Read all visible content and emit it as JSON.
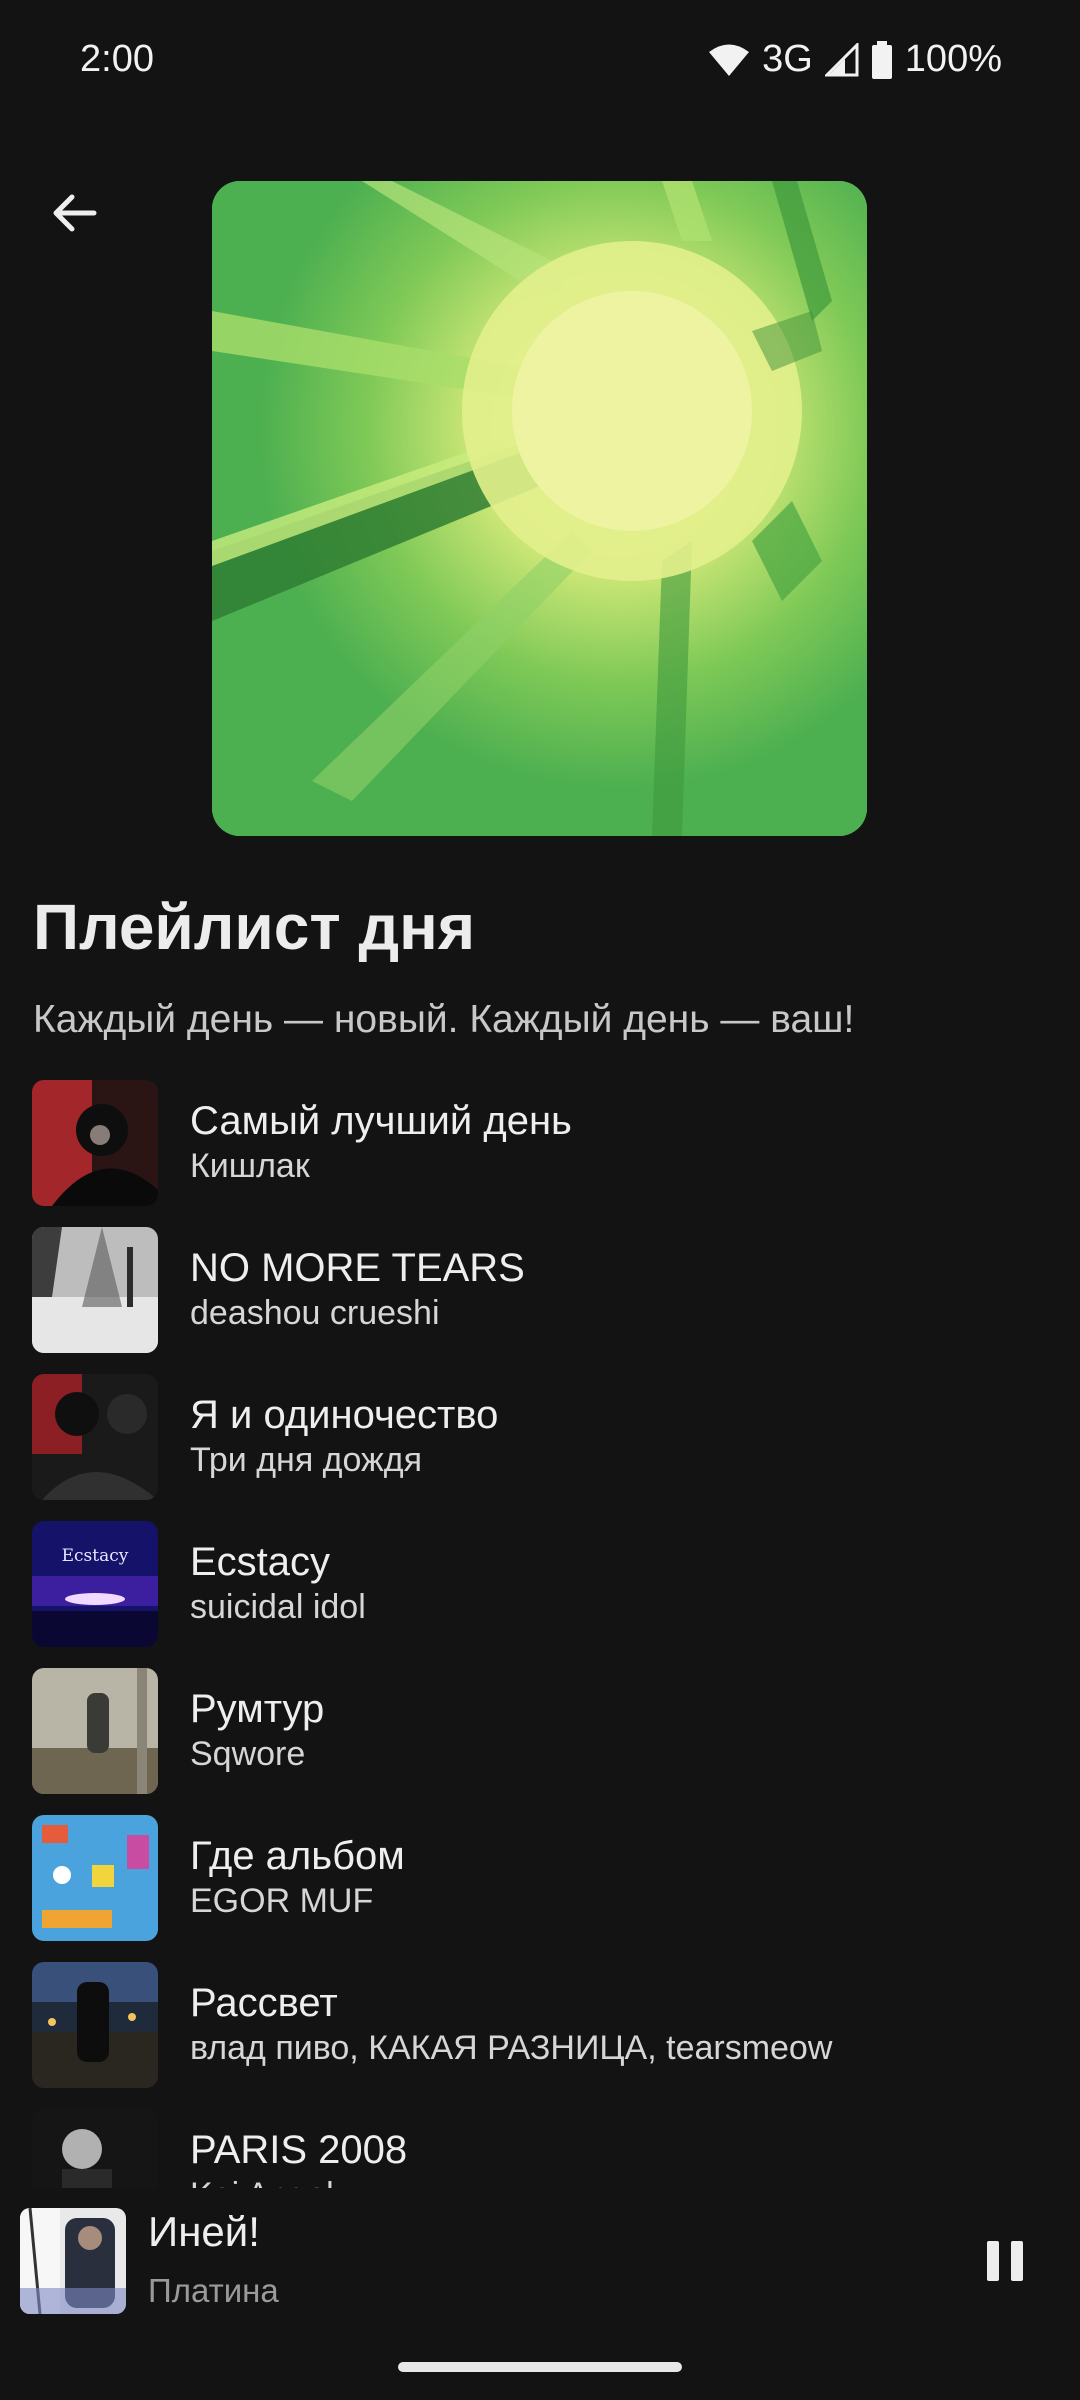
{
  "status_bar": {
    "time": "2:00",
    "network": "3G",
    "battery": "100%",
    "icons": [
      "wifi-icon",
      "signal-icon",
      "battery-icon"
    ]
  },
  "header": {
    "back_icon": "arrow-left-icon"
  },
  "playlist": {
    "title": "Плейлист дня",
    "subtitle": "Каждый день — новый. Каждый день — ваш!",
    "cover_icon": "sun-rays-cover"
  },
  "tracks": [
    {
      "title": "Самый лучший день",
      "artist": "Кишлак"
    },
    {
      "title": "NO MORE TEARS",
      "artist": "deashou crueshi"
    },
    {
      "title": "Я и одиночество",
      "artist": "Три дня дождя"
    },
    {
      "title": "Ecstacy",
      "artist": "suicidal idol",
      "cover_text": "Ecstacy"
    },
    {
      "title": "Румтур",
      "artist": "Sqwore"
    },
    {
      "title": "Где альбом",
      "artist": "EGOR MUF"
    },
    {
      "title": "Рассвет",
      "artist": "влад пиво, КАКАЯ РАЗНИЦА, tearsmeow"
    },
    {
      "title": "PARIS 2008",
      "artist": "Kai Angel"
    }
  ],
  "now_playing": {
    "title": "Иней!",
    "artist": "Платина",
    "pause_icon": "pause-icon"
  },
  "colors": {
    "background": "#131313",
    "cover_green": "#4caf50",
    "text_primary": "#eeeeee",
    "text_secondary": "#9a9a9a"
  }
}
